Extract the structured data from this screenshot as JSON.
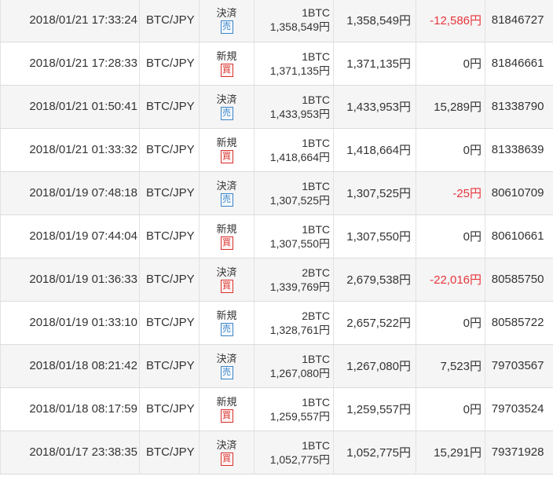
{
  "theme": {
    "sell_color": "#3a83c7",
    "buy_color": "#d9302b",
    "loss_color": "#e8353b"
  },
  "rows": [
    {
      "datetime": "2018/01/21 17:33:24",
      "pair": "BTC/JPY",
      "type": "決済",
      "side": "売",
      "side_kind": "sell",
      "qty": "1BTC",
      "price": "1,358,549円",
      "amount": "1,358,549円",
      "pl": "-12,586円",
      "pl_negative": true,
      "order_id": "81846727"
    },
    {
      "datetime": "2018/01/21 17:28:33",
      "pair": "BTC/JPY",
      "type": "新規",
      "side": "買",
      "side_kind": "buy",
      "qty": "1BTC",
      "price": "1,371,135円",
      "amount": "1,371,135円",
      "pl": "0円",
      "pl_negative": false,
      "order_id": "81846661"
    },
    {
      "datetime": "2018/01/21 01:50:41",
      "pair": "BTC/JPY",
      "type": "決済",
      "side": "売",
      "side_kind": "sell",
      "qty": "1BTC",
      "price": "1,433,953円",
      "amount": "1,433,953円",
      "pl": "15,289円",
      "pl_negative": false,
      "order_id": "81338790"
    },
    {
      "datetime": "2018/01/21 01:33:32",
      "pair": "BTC/JPY",
      "type": "新規",
      "side": "買",
      "side_kind": "buy",
      "qty": "1BTC",
      "price": "1,418,664円",
      "amount": "1,418,664円",
      "pl": "0円",
      "pl_negative": false,
      "order_id": "81338639"
    },
    {
      "datetime": "2018/01/19 07:48:18",
      "pair": "BTC/JPY",
      "type": "決済",
      "side": "売",
      "side_kind": "sell",
      "qty": "1BTC",
      "price": "1,307,525円",
      "amount": "1,307,525円",
      "pl": "-25円",
      "pl_negative": true,
      "order_id": "80610709"
    },
    {
      "datetime": "2018/01/19 07:44:04",
      "pair": "BTC/JPY",
      "type": "新規",
      "side": "買",
      "side_kind": "buy",
      "qty": "1BTC",
      "price": "1,307,550円",
      "amount": "1,307,550円",
      "pl": "0円",
      "pl_negative": false,
      "order_id": "80610661"
    },
    {
      "datetime": "2018/01/19 01:36:33",
      "pair": "BTC/JPY",
      "type": "決済",
      "side": "買",
      "side_kind": "buy",
      "qty": "2BTC",
      "price": "1,339,769円",
      "amount": "2,679,538円",
      "pl": "-22,016円",
      "pl_negative": true,
      "order_id": "80585750"
    },
    {
      "datetime": "2018/01/19 01:33:10",
      "pair": "BTC/JPY",
      "type": "新規",
      "side": "売",
      "side_kind": "sell",
      "qty": "2BTC",
      "price": "1,328,761円",
      "amount": "2,657,522円",
      "pl": "0円",
      "pl_negative": false,
      "order_id": "80585722"
    },
    {
      "datetime": "2018/01/18 08:21:42",
      "pair": "BTC/JPY",
      "type": "決済",
      "side": "売",
      "side_kind": "sell",
      "qty": "1BTC",
      "price": "1,267,080円",
      "amount": "1,267,080円",
      "pl": "7,523円",
      "pl_negative": false,
      "order_id": "79703567"
    },
    {
      "datetime": "2018/01/18 08:17:59",
      "pair": "BTC/JPY",
      "type": "新規",
      "side": "買",
      "side_kind": "buy",
      "qty": "1BTC",
      "price": "1,259,557円",
      "amount": "1,259,557円",
      "pl": "0円",
      "pl_negative": false,
      "order_id": "79703524"
    },
    {
      "datetime": "2018/01/17 23:38:35",
      "pair": "BTC/JPY",
      "type": "決済",
      "side": "買",
      "side_kind": "buy",
      "qty": "1BTC",
      "price": "1,052,775円",
      "amount": "1,052,775円",
      "pl": "15,291円",
      "pl_negative": false,
      "order_id": "79371928"
    }
  ]
}
